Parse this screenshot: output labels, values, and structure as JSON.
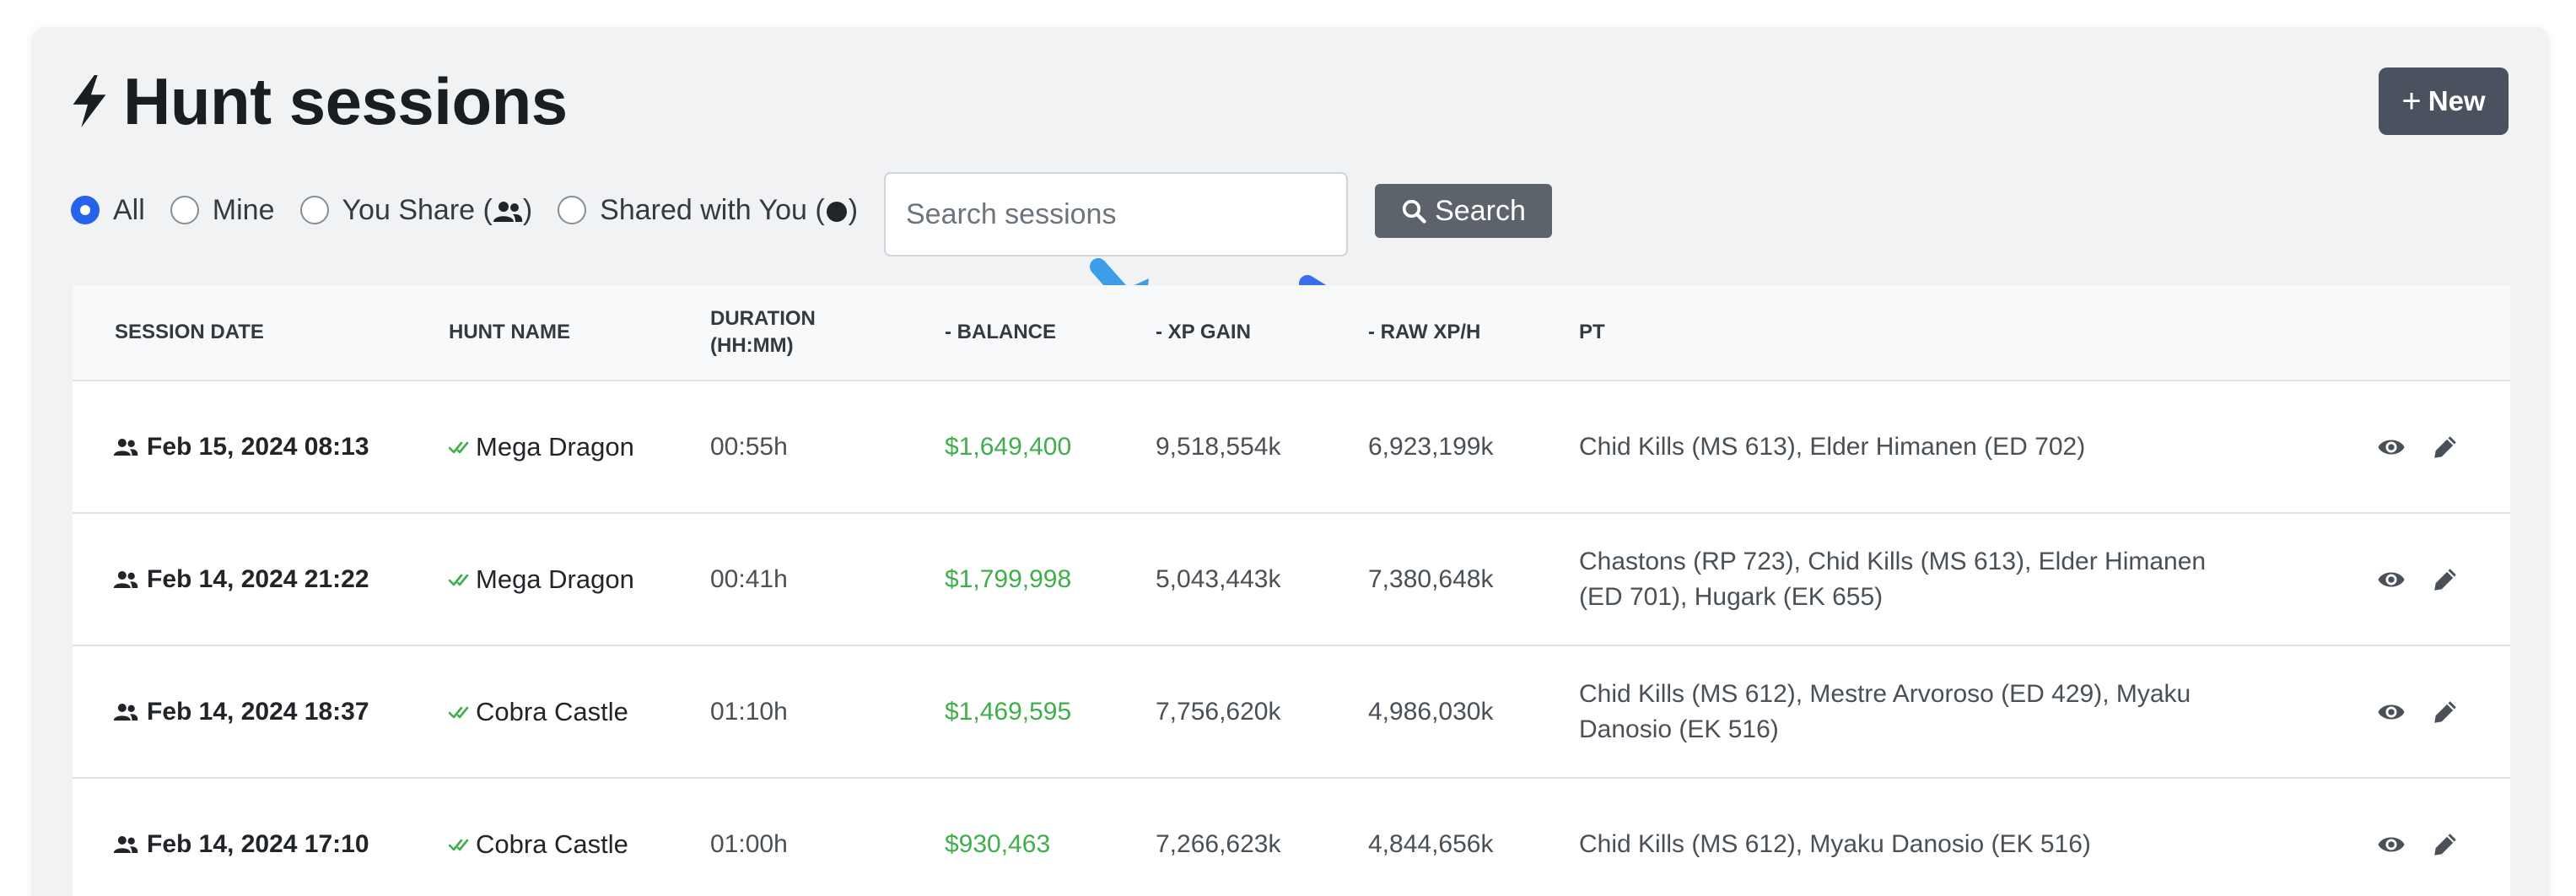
{
  "header": {
    "title": "Hunt sessions",
    "new_label": "New"
  },
  "filters": {
    "options": [
      {
        "label": "All",
        "checked": true
      },
      {
        "label": "Mine",
        "checked": false
      },
      {
        "label": "You Share (",
        "suffix": ")",
        "checked": false
      },
      {
        "label": "Shared with You (",
        "suffix": ")",
        "checked": false
      }
    ]
  },
  "search": {
    "placeholder": "Search sessions",
    "button_label": "Search"
  },
  "table": {
    "headers": {
      "session_date": "SESSION DATE",
      "hunt_name": "HUNT NAME",
      "duration_line1": "DURATION",
      "duration_line2": "(HH:MM)",
      "balance": "- BALANCE",
      "xp_gain": "- XP GAIN",
      "raw_xph": "- RAW XP/H",
      "pt": "PT"
    },
    "rows": [
      {
        "date": "Feb 15, 2024 08:13",
        "hunt": "Mega Dragon",
        "duration": "00:55h",
        "balance": "$1,649,400",
        "xp_gain": "9,518,554k",
        "raw_xph": "6,923,199k",
        "pt": "Chid Kills (MS 613), Elder Himanen (ED 702)"
      },
      {
        "date": "Feb 14, 2024 21:22",
        "hunt": "Mega Dragon",
        "duration": "00:41h",
        "balance": "$1,799,998",
        "xp_gain": "5,043,443k",
        "raw_xph": "7,380,648k",
        "pt": "Chastons (RP 723), Chid Kills (MS 613), Elder Himanen (ED 701), Hugark (EK 655)"
      },
      {
        "date": "Feb 14, 2024 18:37",
        "hunt": "Cobra Castle",
        "duration": "01:10h",
        "balance": "$1,469,595",
        "xp_gain": "7,756,620k",
        "raw_xph": "4,986,030k",
        "pt": "Chid Kills (MS 612), Mestre Arvoroso (ED 429), Myaku Danosio (EK 516)"
      },
      {
        "date": "Feb 14, 2024 17:10",
        "hunt": "Cobra Castle",
        "duration": "01:00h",
        "balance": "$930,463",
        "xp_gain": "7,266,623k",
        "raw_xph": "4,844,656k",
        "pt": "Chid Kills (MS 612), Myaku Danosio (EK 516)"
      }
    ]
  },
  "icons": {
    "title": "bolt-icon",
    "new": "plus-icon",
    "search": "magnifier-icon",
    "shared": "users-icon",
    "verified": "check-double-icon",
    "view": "eye-icon",
    "edit": "pencil-icon",
    "arrows": "arrow-icon"
  },
  "colors": {
    "balance": "#3fae4b",
    "radio_checked": "#2563eb",
    "new_button": "#4a5260",
    "search_button": "#5c636a",
    "arrow_light": "#56b8f2",
    "arrow_mid": "#3c9ee8",
    "arrow_dark": "#3a6ee8"
  }
}
